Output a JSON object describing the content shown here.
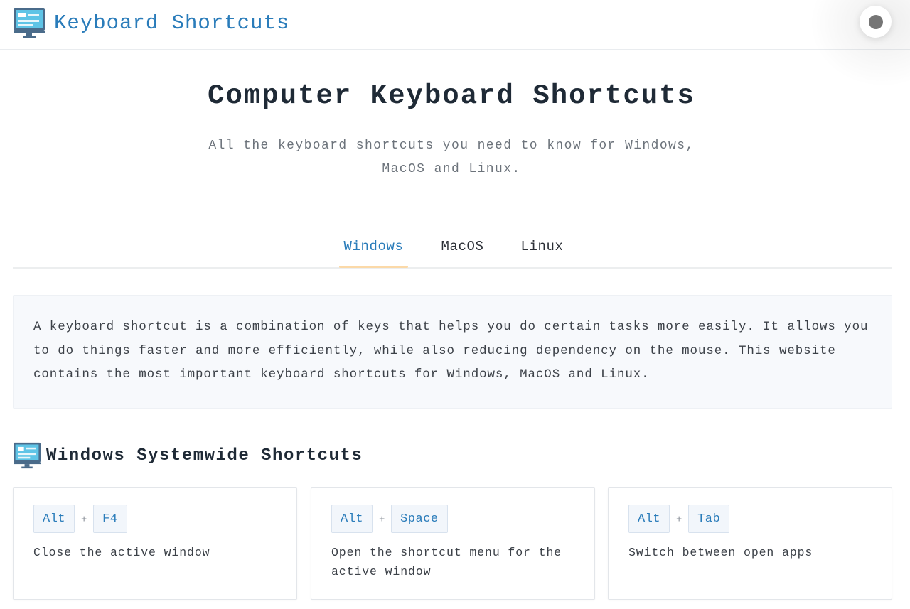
{
  "header": {
    "site_title": "Keyboard Shortcuts",
    "logo_icon": "computer-monitor-icon",
    "theme_toggle_icon": "theme-toggle-icon"
  },
  "hero": {
    "title": "Computer Keyboard Shortcuts",
    "subtitle": "All the keyboard shortcuts you need to know for Windows, MacOS and Linux."
  },
  "tabs": [
    {
      "label": "Windows",
      "active": true
    },
    {
      "label": "MacOS",
      "active": false
    },
    {
      "label": "Linux",
      "active": false
    }
  ],
  "intro": {
    "text": "A keyboard shortcut is a combination of keys that helps you do certain tasks more easily. It allows you to do things faster and more efficiently, while also reducing dependency on the mouse. This website contains the most important keyboard shortcuts for Windows, MacOS and Linux."
  },
  "section": {
    "title": "Windows Systemwide Shortcuts",
    "icon": "computer-monitor-icon"
  },
  "shortcuts": [
    {
      "keys": [
        "Alt",
        "F4"
      ],
      "separator": "+",
      "description": "Close the active window"
    },
    {
      "keys": [
        "Alt",
        "Space"
      ],
      "separator": "+",
      "description": "Open the shortcut menu for the active window"
    },
    {
      "keys": [
        "Alt",
        "Tab"
      ],
      "separator": "+",
      "description": "Switch between open apps"
    }
  ],
  "colors": {
    "accent": "#2a7cba",
    "tab_underline": "#fbd9a8",
    "intro_bg": "#f7f9fc",
    "key_bg": "#f2f6fb"
  }
}
